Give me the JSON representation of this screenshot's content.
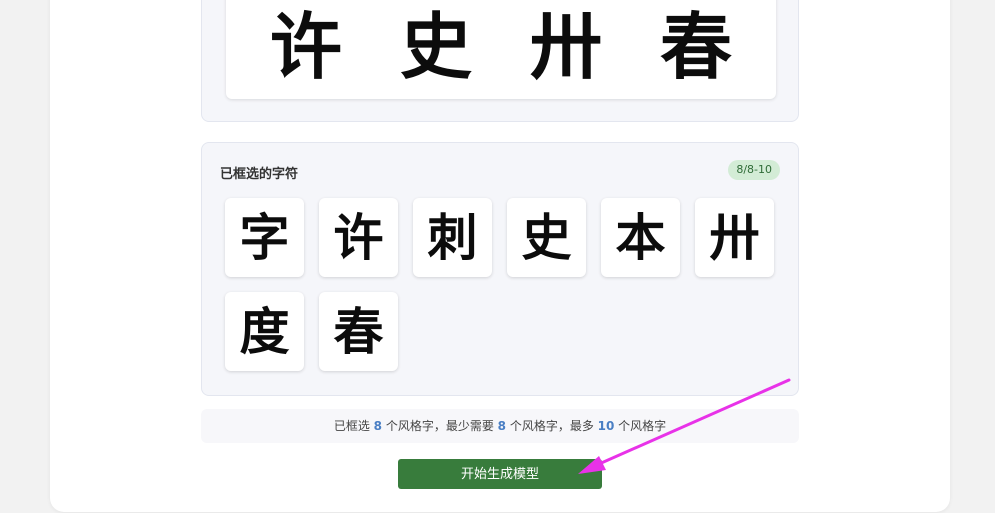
{
  "preview": {
    "glyphs": [
      "许",
      "史",
      "卅",
      "春"
    ]
  },
  "selected_panel": {
    "title": "已框选的字符",
    "badge": "8/8-10",
    "characters": [
      "字",
      "许",
      "刺",
      "史",
      "本",
      "卅",
      "度",
      "春"
    ]
  },
  "summary": {
    "part1": "已框选 ",
    "selected_count": "8",
    "part2": " 个风格字，最少需要 ",
    "min_count": "8",
    "part3": " 个风格字，最多 ",
    "max_count": "10",
    "part4": " 个风格字"
  },
  "actions": {
    "generate_label": "开始生成模型"
  },
  "colors": {
    "accent_green": "#387c3c",
    "badge_bg": "#d3ecd6",
    "number_blue": "#4a7fc4",
    "annotation_magenta": "#e832e8"
  }
}
